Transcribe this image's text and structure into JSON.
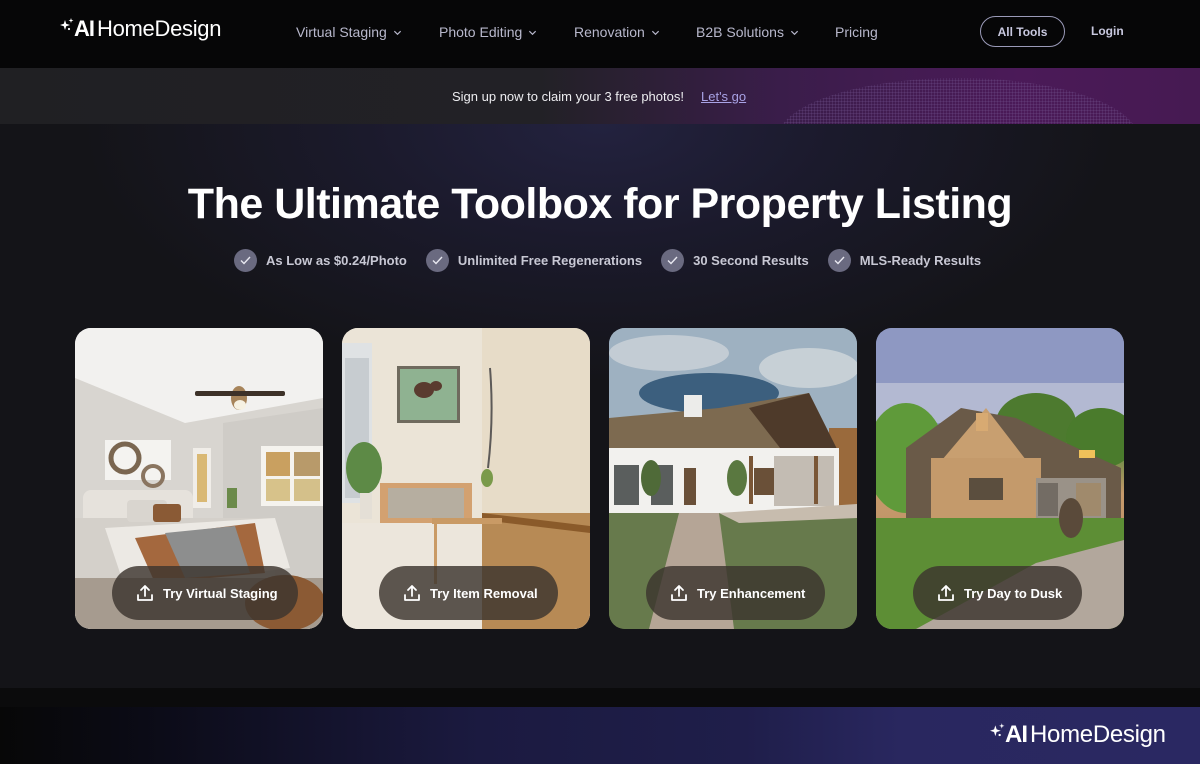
{
  "header": {
    "logo": {
      "prefix": "AI",
      "name": "HomeDesign"
    },
    "nav": [
      {
        "label": "Virtual Staging",
        "has_dropdown": true
      },
      {
        "label": "Photo Editing",
        "has_dropdown": true
      },
      {
        "label": "Renovation",
        "has_dropdown": true
      },
      {
        "label": "B2B Solutions",
        "has_dropdown": true
      },
      {
        "label": "Pricing",
        "has_dropdown": false
      }
    ],
    "all_tools_label": "All Tools",
    "login_label": "Login"
  },
  "promo": {
    "text": "Sign up now to claim your 3 free photos!",
    "link_label": "Let's go"
  },
  "hero": {
    "title": "The Ultimate Toolbox for Property Listing",
    "features": [
      "As Low as $0.24/Photo",
      "Unlimited Free Regenerations",
      "30 Second Results",
      "MLS-Ready Results"
    ],
    "cards": [
      {
        "scene": "staged-bedroom",
        "button_label": "Try Virtual Staging"
      },
      {
        "scene": "empty-room",
        "button_label": "Try Item Removal"
      },
      {
        "scene": "house-exterior-cloudy",
        "button_label": "Try Enhancement"
      },
      {
        "scene": "stone-house-evening",
        "button_label": "Try Day to Dusk"
      }
    ]
  },
  "footer": {
    "logo": {
      "prefix": "AI",
      "name": "HomeDesign"
    }
  },
  "colors": {
    "header_bg": "#060607",
    "page_bg": "#131316",
    "promo_accent": "#4b1a58",
    "link": "#a9a3e6",
    "nav_text": "#b8b8cc",
    "check_badge": "#6a6a80",
    "footer_accent": "#2a2862"
  }
}
